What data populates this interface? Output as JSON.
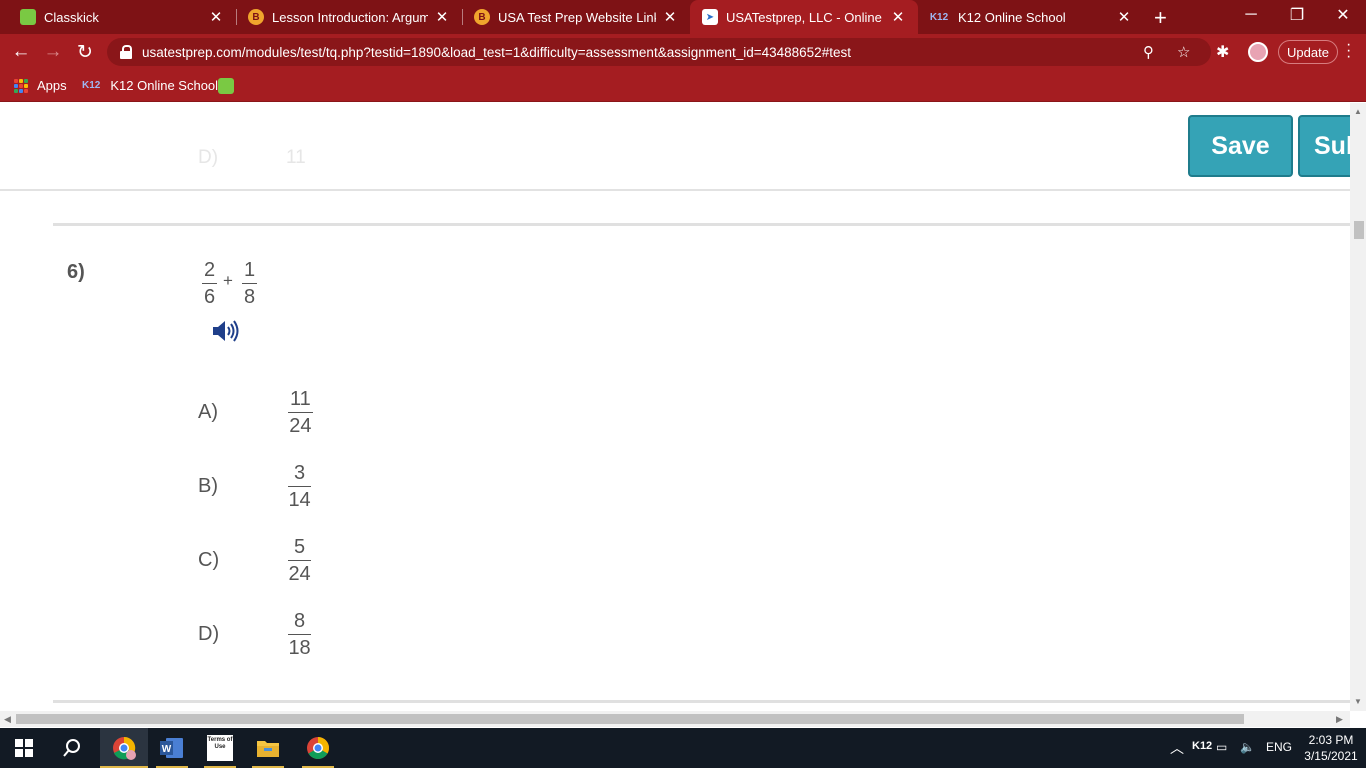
{
  "browser": {
    "tabs": [
      {
        "title": "Classkick",
        "favicon": "classkick-icon"
      },
      {
        "title": "Lesson Introduction: Argument",
        "favicon": "bookshelf-icon"
      },
      {
        "title": "USA Test Prep Website Link",
        "favicon": "bookshelf-icon"
      },
      {
        "title": "USATestprep, LLC - Online State",
        "favicon": "usatestprep-icon"
      },
      {
        "title": "K12 Online School",
        "favicon": "k12-icon"
      }
    ],
    "active_tab_index": 3,
    "url": "usatestprep.com/modules/test/tq.php?testid=1890&load_test=1&difficulty=assessment&assignment_id=43488652#test",
    "update_label": "Update",
    "bookmarks": [
      {
        "label": "Apps",
        "icon": "apps-grid-icon"
      },
      {
        "label": "K12 Online School",
        "icon": "k12-icon"
      },
      {
        "label": "",
        "icon": "classkick-icon"
      }
    ],
    "theme_color": "#a51d21"
  },
  "header": {
    "previous_option_label": "D)",
    "previous_option_value": "11",
    "save_label": "Save",
    "submit_label": "Sub",
    "button_color": "#35a3b6"
  },
  "question": {
    "number": "6)",
    "expression": {
      "left": {
        "numerator": "2",
        "denominator": "6"
      },
      "operator": "+",
      "right": {
        "numerator": "1",
        "denominator": "8"
      }
    },
    "audio_icon": "speaker-icon",
    "options": [
      {
        "label": "A)",
        "numerator": "11",
        "denominator": "24"
      },
      {
        "label": "B)",
        "numerator": "3",
        "denominator": "14"
      },
      {
        "label": "C)",
        "numerator": "5",
        "denominator": "24"
      },
      {
        "label": "D)",
        "numerator": "8",
        "denominator": "18"
      }
    ]
  },
  "taskbar": {
    "apps": [
      "windows-start-icon",
      "search-icon",
      "chrome-profile-icon",
      "word-icon",
      "terms-of-use-icon",
      "file-explorer-icon",
      "chrome-icon"
    ],
    "terms_icon_text": "Terms of Use",
    "tray": {
      "k12_label": "K12",
      "language": "ENG",
      "time": "2:03 PM",
      "date": "3/15/2021"
    }
  }
}
